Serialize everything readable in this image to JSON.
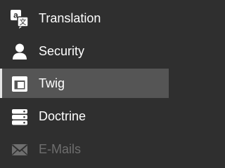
{
  "sidebar": {
    "items": [
      {
        "label": "Translation",
        "icon": "translation-icon",
        "active": false,
        "disabled": false
      },
      {
        "label": "Security",
        "icon": "user-icon",
        "active": false,
        "disabled": false
      },
      {
        "label": "Twig",
        "icon": "layout-icon",
        "active": true,
        "disabled": false
      },
      {
        "label": "Doctrine",
        "icon": "database-icon",
        "active": false,
        "disabled": false
      },
      {
        "label": "E-Mails",
        "icon": "envelope-icon",
        "active": false,
        "disabled": true
      }
    ]
  },
  "colors": {
    "background": "#2f2f2f",
    "active_background": "#555555",
    "text": "#ffffff",
    "disabled_text": "#6e6e6e"
  }
}
